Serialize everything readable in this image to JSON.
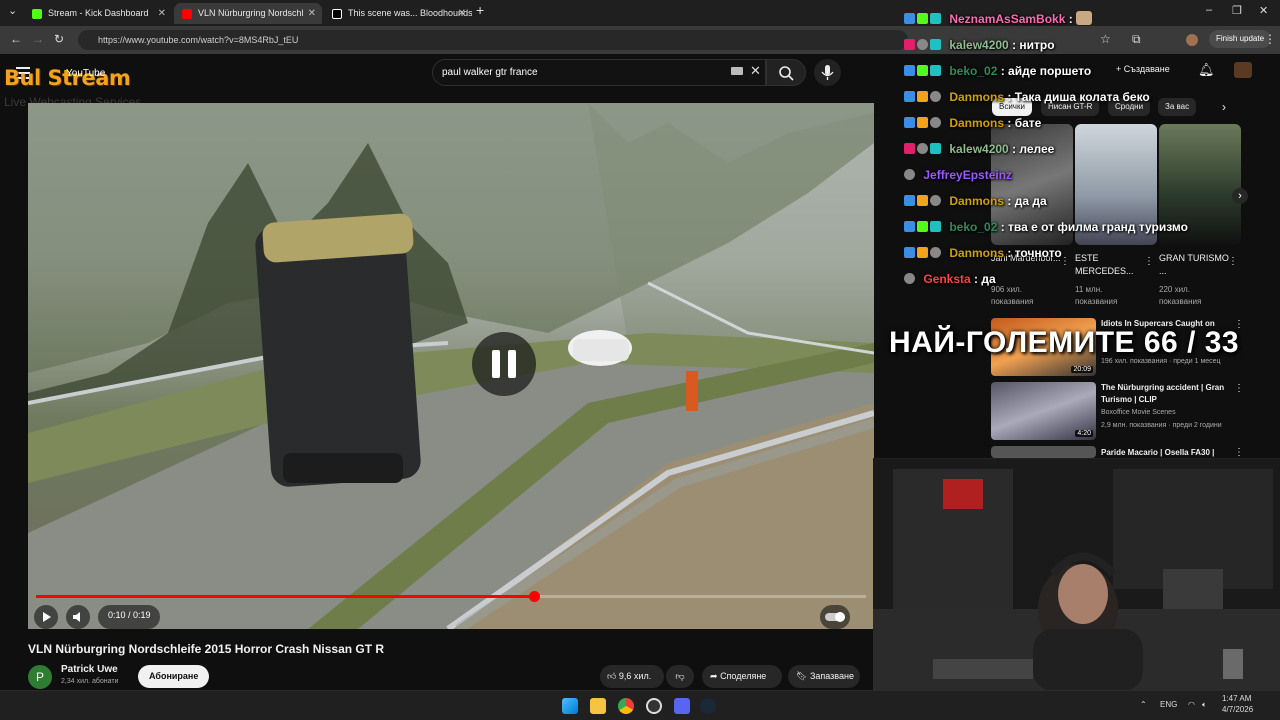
{
  "browser": {
    "tabs": [
      {
        "title": "Stream - Kick Dashboard",
        "favicon_color": "#53fc18"
      },
      {
        "title": "VLN Nürburgring Nordschl",
        "favicon_color": "#ff0000"
      },
      {
        "title": "This scene was... Bloodhounds",
        "favicon_color": "#ffffff"
      }
    ],
    "url": "https://www.youtube.com/watch?v=8MS4RbJ_tEU",
    "finish_update_label": "Finish update"
  },
  "youtube": {
    "logo_text": "Bul Stream",
    "logo_sub": "Live Webcasting Services",
    "logo_yt": "YouTube",
    "search_query": "paul walker gtr france",
    "create_label": "Създаване",
    "player": {
      "progress_fraction": 0.6,
      "time_current": "0:10",
      "time_total": "0:19"
    },
    "video": {
      "title": "VLN Nürburgring Nordschleife 2015 Horror Crash Nissan GT R",
      "channel_initial": "P",
      "channel_name": "Patrick Uwe",
      "subscribers": "2,34 хил. абонати",
      "subscribe_label": "Абониране",
      "likes": "9,6 хил.",
      "share_label": "Споделяне",
      "save_label": "Запазване"
    },
    "chips": [
      "Всички",
      "Нисан GT-R",
      "Сродни",
      "За вас"
    ],
    "shorts": [
      {
        "title": "Jani Mardenbor...",
        "views": "906 хил. показвания"
      },
      {
        "title": "ESTE MERCEDES...",
        "views": "11 млн. показвания"
      },
      {
        "title": "GRAN TURISMO ...",
        "views": "220 хил. показвания"
      }
    ],
    "recommended": [
      {
        "title": "Idiots In Supercars Caught on",
        "channel": "",
        "meta": "196 хил. показвания · преди 1 месец",
        "duration": "20:09"
      },
      {
        "title": "The Nürburgring accident | Gran Turismo | CLIP",
        "channel": "Boxoffice Movie Scenes",
        "meta": "2,9 млн. показвания · преди 2 години",
        "duration": "4:20"
      },
      {
        "title": "Paride Macario | Osella FA30 |",
        "channel": "",
        "meta": "",
        "duration": ""
      }
    ]
  },
  "chat": [
    {
      "user": "NeznamAsSamBokk",
      "msg": "",
      "color": "#ff69b4"
    },
    {
      "user": "kalew4200",
      "msg": "нитро",
      "color": "#8fbc8f"
    },
    {
      "user": "beko_02",
      "msg": "айде поршето",
      "color": "#2e8b57"
    },
    {
      "user": "Danmons",
      "msg": "Така диша колата беко",
      "color": "#d2a000"
    },
    {
      "user": "Danmons",
      "msg": "бате",
      "color": "#d2a000"
    },
    {
      "user": "kalew4200",
      "msg": "лелее",
      "color": "#8fbc8f"
    },
    {
      "user": "JeffreyEpsteinz",
      "msg": "",
      "color": "#9b59ff"
    },
    {
      "user": "Danmons",
      "msg": "да да",
      "color": "#d2a000"
    },
    {
      "user": "beko_02",
      "msg": "тва е от филма гранд туризмо",
      "color": "#2e8b57"
    },
    {
      "user": "Danmons",
      "msg": "точното",
      "color": "#d2a000"
    },
    {
      "user": "Genksta",
      "msg": "да",
      "color": "#ff4040"
    }
  ],
  "overlay_counter": "НАЙ-ГОЛЕМИТЕ 66 / 33",
  "taskbar": {
    "lang": "ENG",
    "time": "1:47 AM",
    "date": "4/7/2026"
  }
}
